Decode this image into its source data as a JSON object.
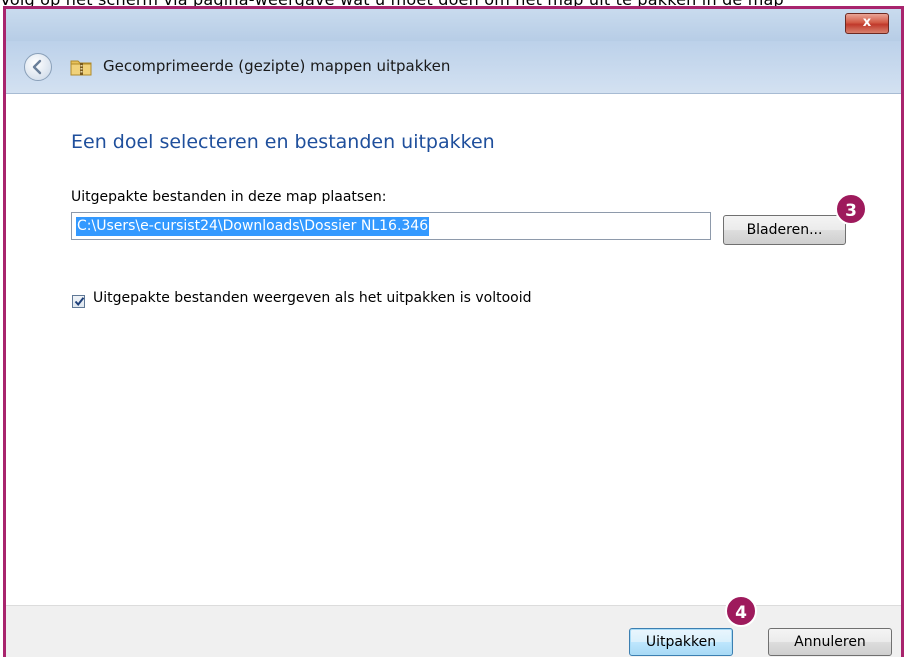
{
  "instruction_text": "Volg op het scherm via pagina-weergave wat u moet doen om het map uit te pakken in de map",
  "window": {
    "title": "Gecomprimeerde (gezipte) mappen uitpakken",
    "close_glyph": "x"
  },
  "content": {
    "heading": "Een doel selecteren en bestanden uitpakken",
    "target_label": "Uitgepakte bestanden in deze map plaatsen:",
    "target_path": "C:\\Users\\e-cursist24\\Downloads\\Dossier NL16.346",
    "browse_label": "Bladeren...",
    "show_files_label": "Uitgepakte bestanden weergeven als het uitpakken is voltooid",
    "show_files_checked": true
  },
  "footer": {
    "extract_label": "Uitpakken",
    "cancel_label": "Annuleren"
  },
  "markers": [
    "3",
    "4"
  ],
  "colors": {
    "heading": "#1f4f9c",
    "marker": "#9e1a5c",
    "selection": "#3399ff",
    "frame": "#a8246d"
  }
}
